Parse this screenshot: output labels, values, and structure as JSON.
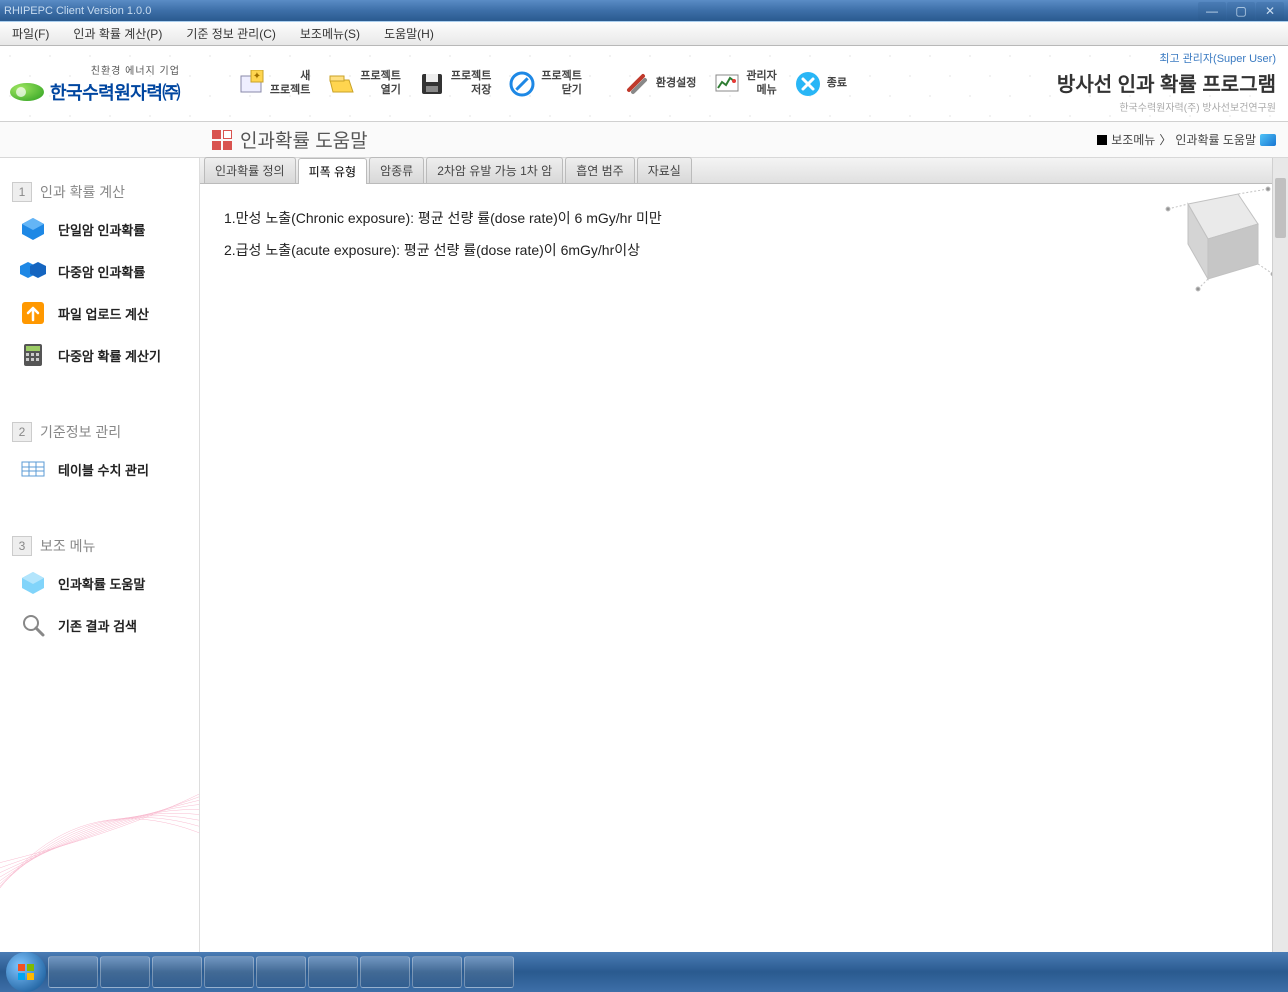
{
  "window": {
    "title": "RHIPEPC Client Version 1.0.0"
  },
  "menubar": {
    "items": [
      "파일(F)",
      "인과 확률 계산(P)",
      "기준 정보 관리(C)",
      "보조메뉴(S)",
      "도움말(H)"
    ]
  },
  "logo": {
    "tagline": "친환경 에너지 기업",
    "company": "한국수력원자력㈜"
  },
  "toolbar": {
    "items": [
      {
        "label": "새\n프로젝트",
        "icon": "new-project-icon"
      },
      {
        "label": "프로젝트\n열기",
        "icon": "open-project-icon"
      },
      {
        "label": "프로젝트\n저장",
        "icon": "save-project-icon"
      },
      {
        "label": "프로젝트\n닫기",
        "icon": "close-project-icon"
      },
      {
        "label": "환경설정",
        "icon": "settings-icon"
      },
      {
        "label": "관리자\n메뉴",
        "icon": "admin-menu-icon"
      },
      {
        "label": "종료",
        "icon": "exit-icon"
      }
    ]
  },
  "header_right": {
    "user": "최고 관리자(Super User)",
    "program_title": "방사선 인과 확률 프로그램",
    "program_sub": "한국수력원자력(주) 방사선보건연구원"
  },
  "page": {
    "title": "인과확률 도움말"
  },
  "breadcrumb": {
    "parent": "보조메뉴",
    "separator": "〉",
    "current": "인과확률 도움말"
  },
  "sidebar": {
    "sections": [
      {
        "num": "1",
        "title": "인과 확률 계산",
        "items": [
          {
            "label": "단일암 인과확률",
            "icon": "cube-blue-icon"
          },
          {
            "label": "다중암 인과확률",
            "icon": "cubes-blue-icon"
          },
          {
            "label": "파일 업로드 계산",
            "icon": "upload-orange-icon"
          },
          {
            "label": "다중암 확률 계산기",
            "icon": "calculator-icon"
          }
        ]
      },
      {
        "num": "2",
        "title": "기준정보 관리",
        "items": [
          {
            "label": "테이블 수치 관리",
            "icon": "table-icon"
          }
        ]
      },
      {
        "num": "3",
        "title": "보조 메뉴",
        "items": [
          {
            "label": "인과확률 도움말",
            "icon": "cube-light-icon"
          },
          {
            "label": "기존 결과 검색",
            "icon": "search-icon"
          }
        ]
      }
    ]
  },
  "tabs": {
    "items": [
      "인과확률 정의",
      "피폭 유형",
      "암종류",
      "2차암 유발 가능 1차 암",
      "흡연 범주",
      "자료실"
    ],
    "active_index": 1
  },
  "content": {
    "lines": [
      "1.만성 노출(Chronic exposure): 평균 선량 률(dose rate)이 6 mGy/hr 미만",
      "2.급성 노출(acute exposure): 평균 선량 률(dose rate)이 6mGy/hr이상"
    ]
  }
}
